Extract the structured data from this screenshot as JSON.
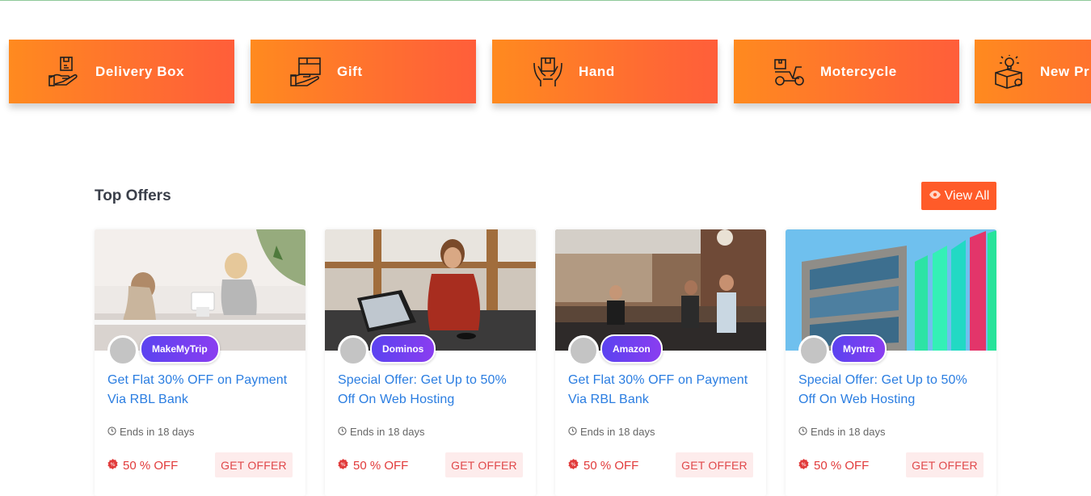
{
  "categories": [
    {
      "label": "Delivery Box",
      "icon": "delivery-box-hand-icon"
    },
    {
      "label": "Gift",
      "icon": "gift-box-hand-icon"
    },
    {
      "label": "Hand",
      "icon": "hands-box-icon"
    },
    {
      "label": "Motercycle",
      "icon": "delivery-scooter-icon"
    },
    {
      "label": "New Pr",
      "icon": "new-product-box-icon"
    }
  ],
  "section": {
    "title": "Top Offers",
    "view_all_label": "View All"
  },
  "offers": [
    {
      "brand": "MakeMyTrip",
      "title": "Get Flat 30% OFF on Payment Via RBL Bank",
      "ends": "Ends in 18 days",
      "discount": "50 % OFF",
      "cta": "GET OFFER"
    },
    {
      "brand": "Dominos",
      "title": "Special Offer: Get Up to 50% Off On Web Hosting",
      "ends": "Ends in 18 days",
      "discount": "50 % OFF",
      "cta": "GET OFFER"
    },
    {
      "brand": "Amazon",
      "title": "Get Flat 30% OFF on Payment Via RBL Bank",
      "ends": "Ends in 18 days",
      "discount": "50 % OFF",
      "cta": "GET OFFER"
    },
    {
      "brand": "Myntra",
      "title": "Special Offer: Get Up to 50% Off On Web Hosting",
      "ends": "Ends in 18 days",
      "discount": "50 % OFF",
      "cta": "GET OFFER"
    }
  ],
  "colors": {
    "tile_gradient_start": "#ff8a1f",
    "tile_gradient_end": "#ff5e3a",
    "view_all_bg": "#ff5b29",
    "title_blue": "#2a7de1",
    "discount_red": "#e13a3a",
    "cta_bg": "#fdecec",
    "brand_pill": "#5b43f0"
  }
}
